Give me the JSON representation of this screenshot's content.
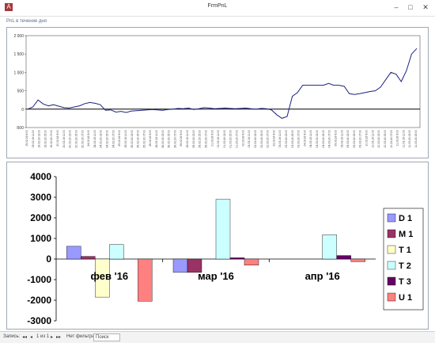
{
  "window": {
    "title": "FrmPnL",
    "app_icon": "A",
    "subtitle": "PnL в течение дня",
    "minimize": "–",
    "maximize": "□",
    "close": "✕"
  },
  "status": {
    "record_label": "Запись:",
    "first": "◂◂",
    "prev": "◂",
    "position": "1 из 1",
    "next": "▸",
    "last": "▸▸",
    "filter_label": "Нет фильтра",
    "search": "Поиск"
  },
  "line_chart": {
    "type": "line",
    "color": "#1a237e",
    "y_ticks": [
      "2 000",
      "1 500",
      "1 000",
      "500",
      "0",
      "-500"
    ],
    "ylim": [
      -500,
      2000
    ],
    "y": [
      0,
      60,
      250,
      140,
      90,
      120,
      80,
      40,
      30,
      60,
      90,
      150,
      180,
      160,
      120,
      -30,
      -20,
      -80,
      -60,
      -90,
      -50,
      -40,
      -30,
      -20,
      -10,
      -20,
      -30,
      -10,
      0,
      20,
      10,
      30,
      -10,
      10,
      40,
      30,
      10,
      20,
      30,
      20,
      10,
      20,
      30,
      10,
      0,
      20,
      10,
      -20,
      -150,
      -250,
      -200,
      350,
      450,
      650,
      650,
      650,
      650,
      650,
      700,
      650,
      650,
      620,
      420,
      400,
      420,
      450,
      480,
      500,
      600,
      800,
      1000,
      950,
      750,
      1050,
      1500,
      1650
    ],
    "x_ticks": [
      "19.02.16 9:00",
      "19.02.16 11:00",
      "19.02.16 13:00",
      "19.02.16 15:00",
      "19.02.16 17:00",
      "20.02.16 9:00",
      "20.02.16 11:00",
      "20.02.16 13:00",
      "20.02.16 15:00",
      "20.02.16 17:00",
      "24.02.16 9:00",
      "24.02.16 11:00",
      "24.02.16 13:00",
      "24.02.16 15:00",
      "24.02.16 17:00",
      "25.02.16 9:00",
      "25.02.16 11:00",
      "25.02.16 13:00",
      "25.02.16 15:00",
      "25.02.16 17:00",
      "26.02.16 9:00",
      "26.02.16 11:00",
      "26.02.16 13:00",
      "26.02.16 15:00",
      "26.02.16 17:00",
      "29.02.16 9:00",
      "29.02.16 11:00",
      "29.02.16 13:00",
      "29.02.16 15:00",
      "29.02.16 17:00",
      "01.03.16 9:00",
      "01.03.16 11:00",
      "01.03.16 13:00",
      "01.03.16 15:00",
      "01.03.16 17:00",
      "02.03.16 9:00",
      "02.03.16 11:00",
      "02.03.16 13:00",
      "02.03.16 15:00",
      "02.03.16 17:00",
      "03.03.16 9:00",
      "03.03.16 11:00",
      "03.03.16 13:00",
      "03.03.16 15:00",
      "03.03.16 17:00",
      "04.03.16 9:00",
      "04.03.16 11:00",
      "04.03.16 13:00",
      "04.03.16 15:00",
      "04.03.16 17:00",
      "09.03.16 9:00",
      "09.03.16 11:00",
      "09.03.16 13:00",
      "09.03.16 15:00",
      "09.03.16 17:00",
      "10.03.16 9:00",
      "10.03.16 11:00",
      "10.03.16 13:00",
      "10.03.16 15:00",
      "10.03.16 17:00",
      "11.03.16 9:00",
      "11.03.16 11:00",
      "11.03.16 13:00",
      "11.03.16 15:00"
    ]
  },
  "chart_data": {
    "type": "bar",
    "categories": [
      "фев '16",
      "мар '16",
      "апр '16"
    ],
    "ylim": [
      -3000,
      4000
    ],
    "y_ticks": [
      "4000",
      "3000",
      "2000",
      "1000",
      "0",
      "-1000",
      "-2000",
      "-3000"
    ],
    "legend_position": "right",
    "series": [
      {
        "name": "D 1",
        "color": "#9999ff",
        "values": [
          620,
          -650,
          null
        ]
      },
      {
        "name": "M 1",
        "color": "#993366",
        "values": [
          130,
          -650,
          null
        ]
      },
      {
        "name": "T 1",
        "color": "#ffffcc",
        "values": [
          -1850,
          null,
          null
        ]
      },
      {
        "name": "T 2",
        "color": "#ccffff",
        "values": [
          700,
          2900,
          1180
        ]
      },
      {
        "name": "T 3",
        "color": "#660066",
        "values": [
          null,
          60,
          170
        ]
      },
      {
        "name": "U 1",
        "color": "#ff8080",
        "values": [
          -2050,
          -300,
          -130
        ]
      }
    ]
  }
}
